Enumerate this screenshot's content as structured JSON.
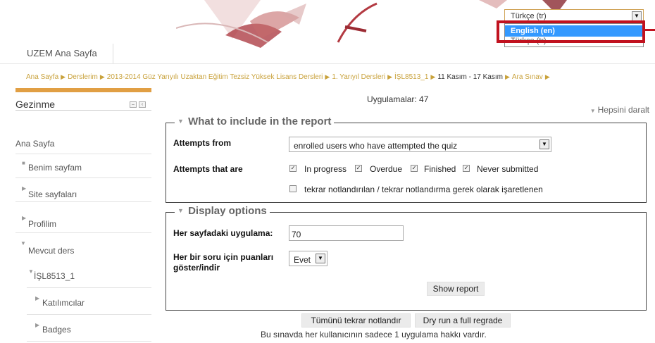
{
  "header": {
    "site_name": "UZEM Ana Sayfa"
  },
  "language": {
    "selected": "Türkçe (tr)",
    "options": [
      "English (en)",
      "Türkçe (tr)"
    ],
    "highlighted": "English (en)"
  },
  "breadcrumb": [
    "Ana Sayfa",
    "Derslerim",
    "2013-2014 Güz Yarıyılı Uzaktan Eğitim Tezsiz Yüksek Lisans Dersleri",
    "1. Yarıyıl Dersleri",
    "İŞL8513_1",
    "11 Kasım - 17 Kasım",
    "Ara Sınav"
  ],
  "sidebar": {
    "title": "Gezinme",
    "items": [
      {
        "label": "Ana Sayfa"
      },
      {
        "label": "Benim sayfam"
      },
      {
        "label": "Site sayfaları"
      },
      {
        "label": "Profilim"
      },
      {
        "label": "Mevcut ders"
      },
      {
        "label": "İŞL8513_1"
      },
      {
        "label": "Katılımcılar"
      },
      {
        "label": "Badges"
      }
    ]
  },
  "main": {
    "attempts_count": "Uygulamalar: 47",
    "collapse_all": "Hepsini daralt",
    "include": {
      "legend": "What to include in the report",
      "attempts_from_label": "Attempts from",
      "attempts_from_value": "enrolled users who have attempted the quiz",
      "attempts_that_are_label": "Attempts that are",
      "states": [
        "In progress",
        "Overdue",
        "Finished",
        "Never submitted"
      ],
      "regrade_label": "tekrar notlandırılan / tekrar notlandırma gerek olarak işaretlenen"
    },
    "display": {
      "legend": "Display options",
      "page_size_label": "Her sayfadaki uygulama:",
      "page_size_value": "70",
      "marks_label_line1": "Her bir soru için puanları",
      "marks_label_line2": "göster/indir",
      "marks_value": "Evet",
      "show_report": "Show report"
    },
    "regrade_all": "Tümünü tekrar notlandır",
    "dry_run": "Dry run a full regrade",
    "footer_note": "Bu sınavda her kullanıcının sadece 1 uygulama hakkı vardır."
  },
  "colors": {
    "accent": "#e19f44",
    "breadcrumb_link": "#c9a23c",
    "highlight": "#c1121f",
    "selected_option": "#3399ff"
  }
}
